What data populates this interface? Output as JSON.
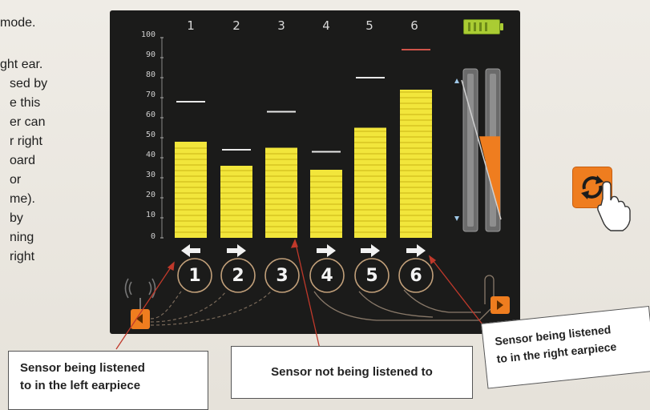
{
  "background_text": {
    "lines": [
      "mode.",
      "ght ear.",
      "sed by",
      "e this",
      "er can",
      "r right",
      "oard",
      "or",
      "me).",
      "by",
      "ning",
      "right"
    ]
  },
  "display": {
    "y_axis_ticks": [
      "100",
      "90",
      "80",
      "70",
      "60",
      "50",
      "40",
      "30",
      "20",
      "10",
      "0"
    ],
    "column_numbers": [
      "1",
      "2",
      "3",
      "4",
      "5",
      "6"
    ],
    "sensors": [
      {
        "id": "1",
        "level": 48,
        "peak": 68,
        "peak_color": "#e8e8e8",
        "arrow": "left"
      },
      {
        "id": "2",
        "level": 36,
        "peak": 44,
        "peak_color": "#e8e8e8",
        "arrow": "right"
      },
      {
        "id": "3",
        "level": 45,
        "peak": 63,
        "peak_color": "#e8e8e8",
        "arrow": "none"
      },
      {
        "id": "4",
        "level": 34,
        "peak": 43,
        "peak_color": "#e8e8e8",
        "arrow": "right"
      },
      {
        "id": "5",
        "level": 55,
        "peak": 80,
        "peak_color": "#e8e8e8",
        "arrow": "right"
      },
      {
        "id": "6",
        "level": 74,
        "peak": 94,
        "peak_color": "#d0544a",
        "arrow": "right"
      }
    ],
    "circle_labels": [
      "1",
      "2",
      "3",
      "4",
      "5",
      "6"
    ],
    "battery_level": 1.0,
    "gain_level": 0.57,
    "colors": {
      "bar_fill": "#f2e63b",
      "bar_line": "#c9b414",
      "accent_orange": "#ef7d1f",
      "screen_bg": "#1b1b1a"
    }
  },
  "refresh_button": {
    "icon": "refresh-icon",
    "cursor": "hand-pointer-icon"
  },
  "callouts": {
    "left": {
      "line1": "Sensor being listened",
      "line2": "to in the left earpiece"
    },
    "middle": {
      "text": "Sensor not being listened to"
    },
    "right": {
      "line1": "Sensor being listened",
      "line2": "to in the right earpiece"
    }
  }
}
